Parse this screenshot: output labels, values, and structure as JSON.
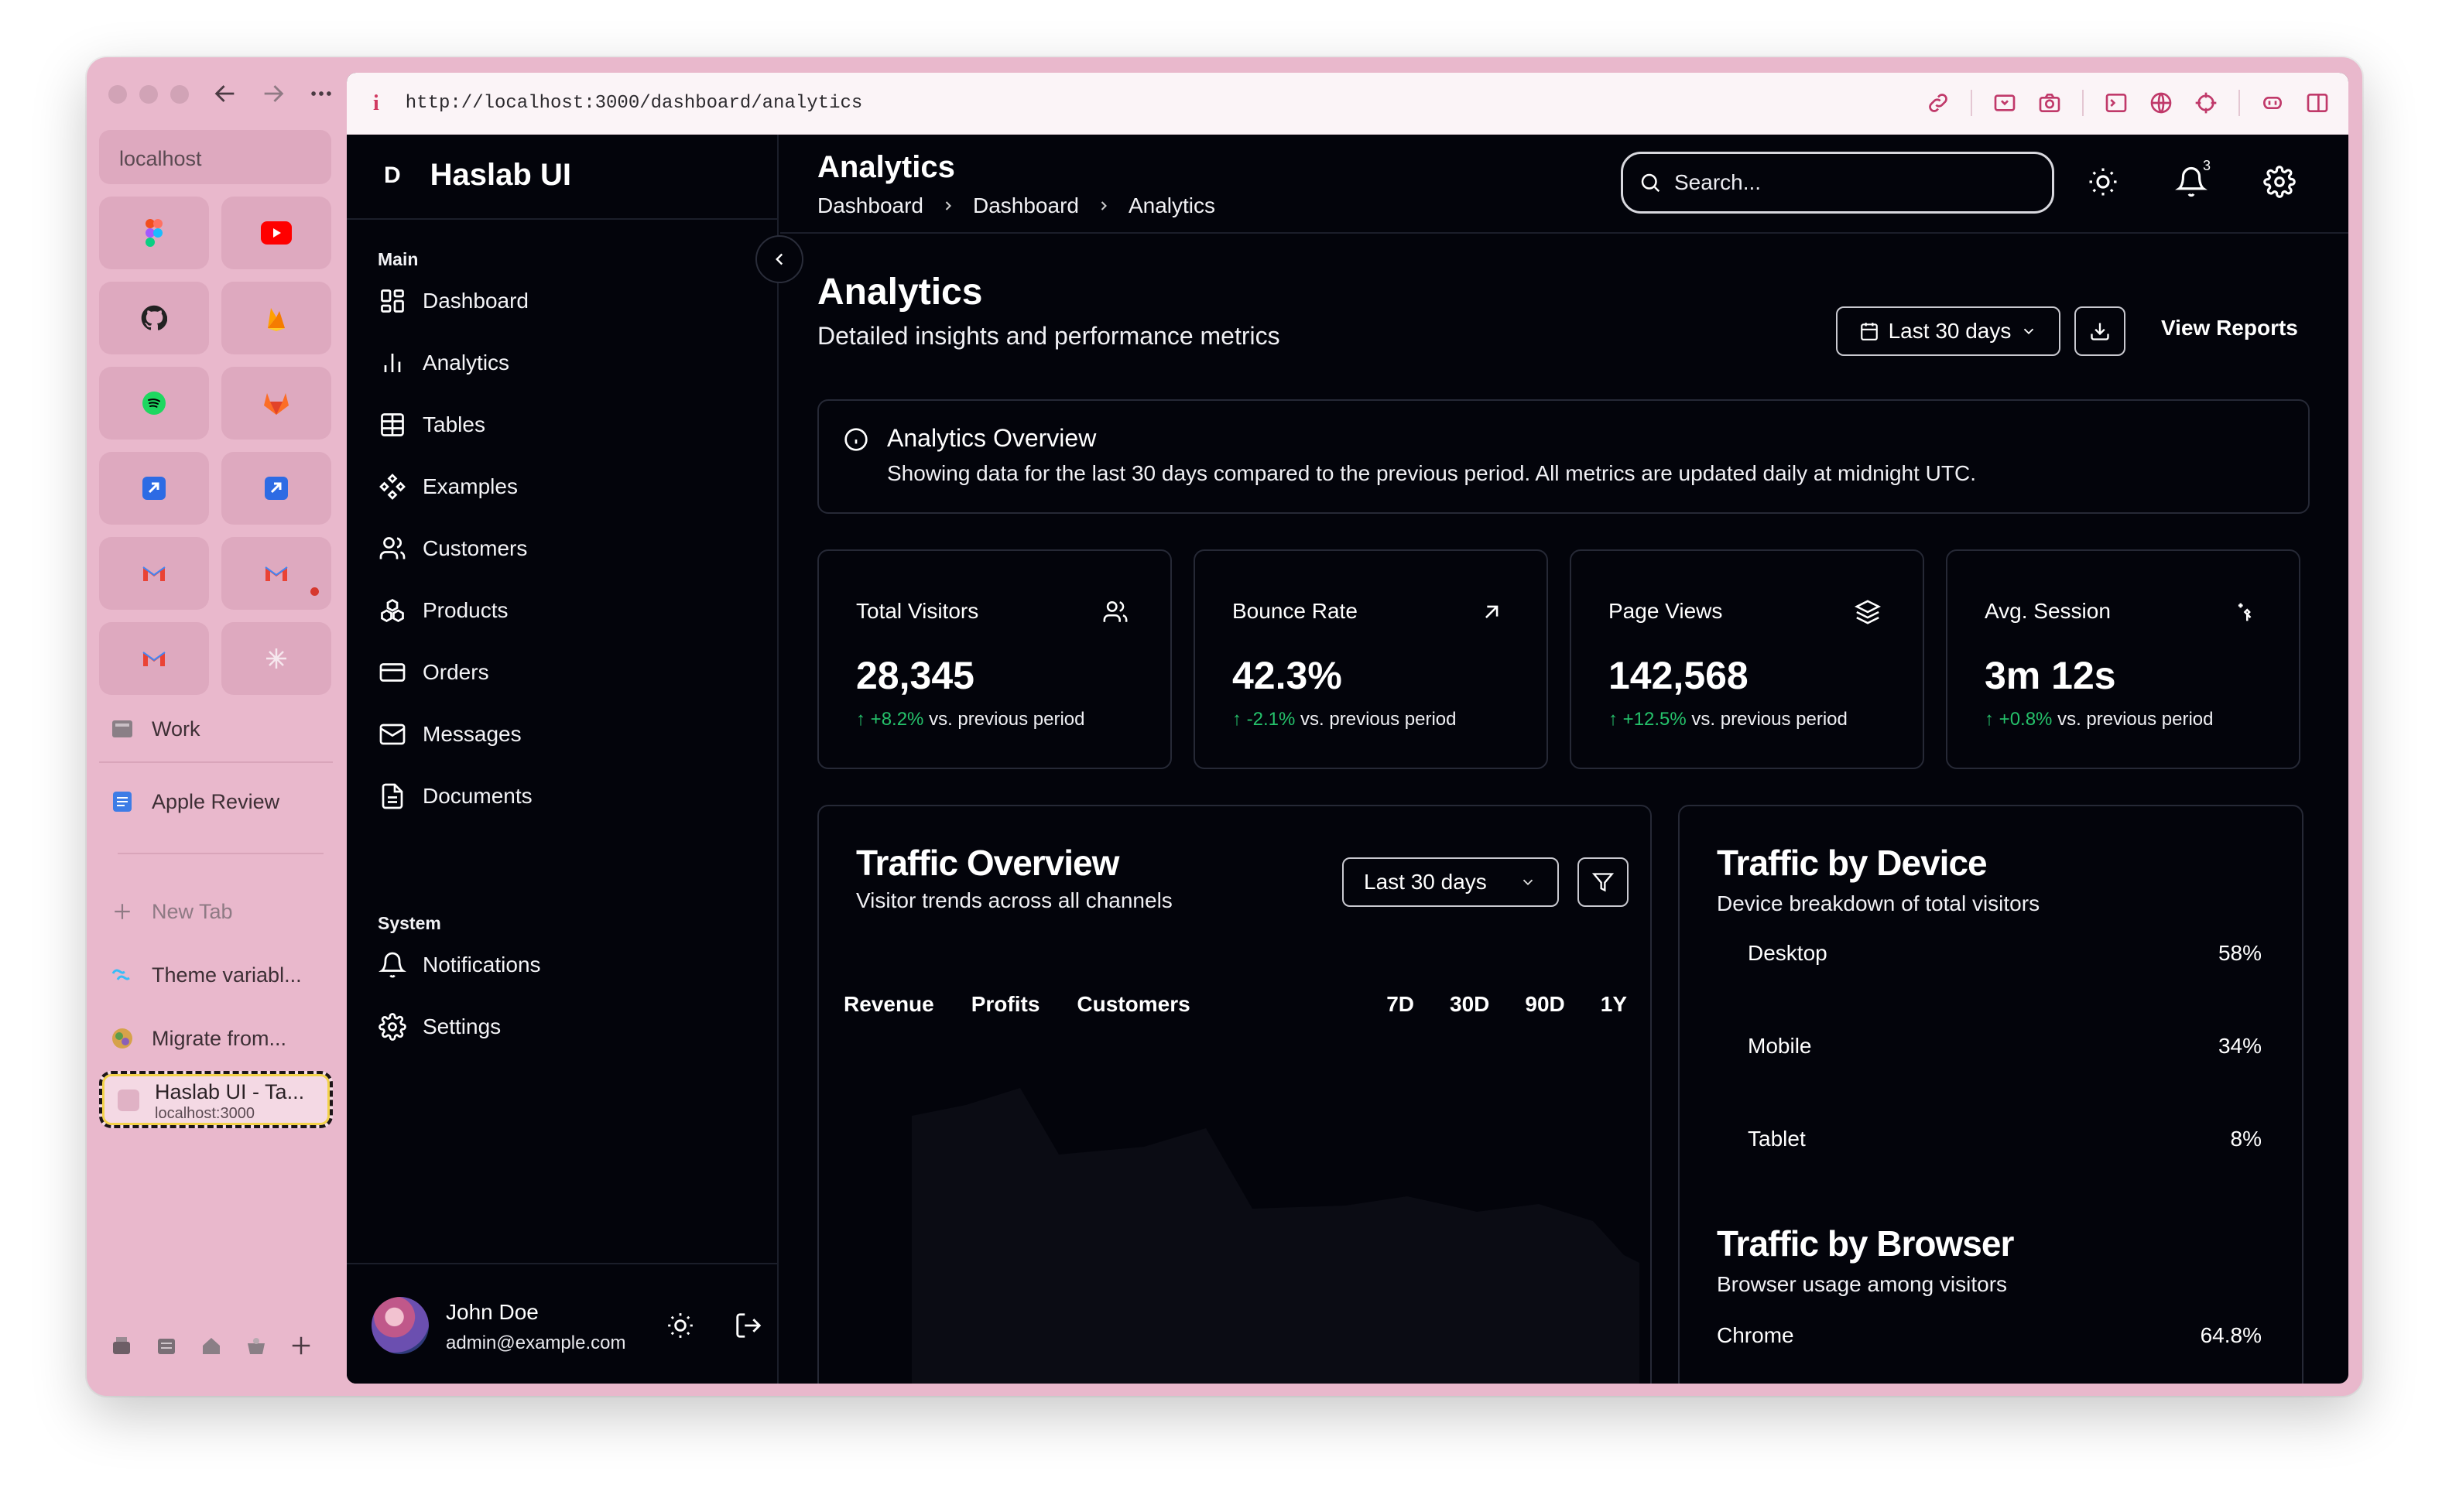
{
  "arc": {
    "url_pill": "localhost",
    "favorites": [
      "figma",
      "youtube",
      "github",
      "firebase",
      "spotify",
      "gitlab",
      "jira",
      "jira",
      "gmail",
      "gmail",
      "gmail",
      "perplexity"
    ],
    "work_label": "Work",
    "apple_review": "Apple Review",
    "new_tab": "New Tab",
    "tabs": [
      "Theme variabl...",
      "Migrate from..."
    ],
    "active_tab_title": "Haslab UI - Ta...",
    "active_tab_url": "localhost:3000"
  },
  "browser": {
    "info_glyph": "i",
    "url": "http://localhost:3000/dashboard/analytics"
  },
  "app": {
    "brand_letter": "D",
    "brand_name": "Haslab UI",
    "main_label": "Main",
    "nav_main": [
      {
        "label": "Dashboard",
        "icon": "layout-grid-icon"
      },
      {
        "label": "Analytics",
        "icon": "bar-chart-icon"
      },
      {
        "label": "Tables",
        "icon": "table-icon"
      },
      {
        "label": "Examples",
        "icon": "component-icon"
      },
      {
        "label": "Customers",
        "icon": "users-icon"
      },
      {
        "label": "Products",
        "icon": "boxes-icon"
      },
      {
        "label": "Orders",
        "icon": "wallet-icon"
      },
      {
        "label": "Messages",
        "icon": "mail-icon"
      },
      {
        "label": "Documents",
        "icon": "file-icon"
      }
    ],
    "system_label": "System",
    "nav_system": [
      {
        "label": "Notifications",
        "icon": "bell-icon"
      },
      {
        "label": "Settings",
        "icon": "gear-icon"
      }
    ],
    "user": {
      "name": "John Doe",
      "email": "admin@example.com"
    }
  },
  "header": {
    "title": "Analytics",
    "breadcrumbs": [
      "Dashboard",
      "Dashboard",
      "Analytics"
    ],
    "search_placeholder": "Search...",
    "notif_count": "3"
  },
  "page": {
    "title": "Analytics",
    "subtitle": "Detailed insights and performance metrics",
    "range_button": "Last 30 days",
    "view_reports": "View Reports",
    "overview_title": "Analytics Overview",
    "overview_text": "Showing data for the last 30 days compared to the previous period. All metrics are updated daily at midnight UTC."
  },
  "stats": [
    {
      "label": "Total Visitors",
      "value": "28,345",
      "change": "+8.2%",
      "suffix": "vs. previous period",
      "icon": "users-icon"
    },
    {
      "label": "Bounce Rate",
      "value": "42.3%",
      "change": "-2.1%",
      "suffix": "vs. previous period",
      "icon": "arrow-up-right-icon"
    },
    {
      "label": "Page Views",
      "value": "142,568",
      "change": "+12.5%",
      "suffix": "vs. previous period",
      "icon": "layers-icon"
    },
    {
      "label": "Avg. Session",
      "value": "3m 12s",
      "change": "+0.8%",
      "suffix": "vs. previous period",
      "icon": "sparkle-icon"
    }
  ],
  "traffic": {
    "title": "Traffic Overview",
    "subtitle": "Visitor trends across all channels",
    "select": "Last 30 days",
    "tabs": [
      "Revenue",
      "Profits",
      "Customers"
    ],
    "ranges": [
      "7D",
      "30D",
      "90D",
      "1Y"
    ]
  },
  "device": {
    "title": "Traffic by Device",
    "subtitle": "Device breakdown of total visitors",
    "rows": [
      {
        "label": "Desktop",
        "value": "58%"
      },
      {
        "label": "Mobile",
        "value": "34%"
      },
      {
        "label": "Tablet",
        "value": "8%"
      }
    ],
    "browser_title": "Traffic by Browser",
    "browser_subtitle": "Browser usage among visitors",
    "browser_rows": [
      {
        "label": "Chrome",
        "value": "64.8%"
      }
    ]
  },
  "colors": {
    "background": "#03040b",
    "positive": "#25c26b",
    "arc_sidebar": "#e9b8cc"
  }
}
